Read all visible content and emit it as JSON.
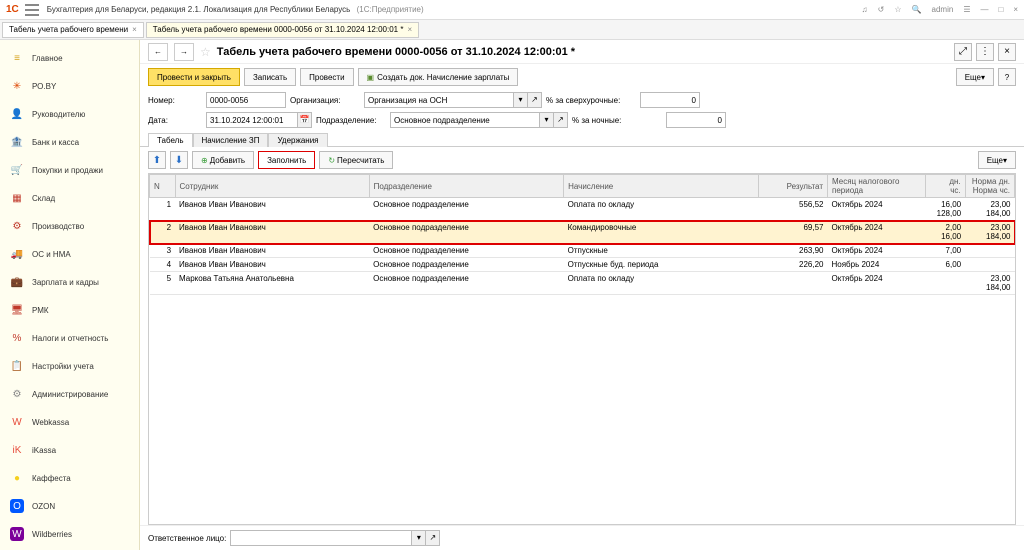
{
  "titlebar": {
    "app": "Бухгалтерия для Беларуси, редакция 2.1. Локализация для Республики Беларусь",
    "platform": "(1С:Предприятие)",
    "user": "admin"
  },
  "tabs": [
    {
      "label": "Табель учета рабочего времени",
      "active": false
    },
    {
      "label": "Табель учета рабочего времени 0000-0056 от 31.10.2024 12:00:01 *",
      "active": true
    }
  ],
  "sidebar": {
    "items": [
      {
        "icon": "≡",
        "color": "#d4a017",
        "label": "Главное"
      },
      {
        "icon": "✳",
        "color": "#d40",
        "label": "РО.BY"
      },
      {
        "icon": "👤",
        "color": "#c0392b",
        "label": "Руководителю"
      },
      {
        "icon": "🏦",
        "color": "#c0392b",
        "label": "Банк и касса"
      },
      {
        "icon": "🛒",
        "color": "#c0392b",
        "label": "Покупки и продажи"
      },
      {
        "icon": "▦",
        "color": "#c0392b",
        "label": "Склад"
      },
      {
        "icon": "⚙",
        "color": "#c0392b",
        "label": "Производство"
      },
      {
        "icon": "🚚",
        "color": "#555",
        "label": "ОС и НМА"
      },
      {
        "icon": "💼",
        "color": "#c0392b",
        "label": "Зарплата и кадры"
      },
      {
        "icon": "🖥",
        "color": "#c0392b",
        "label": "РМК"
      },
      {
        "icon": "%",
        "color": "#c0392b",
        "label": "Налоги и отчетность"
      },
      {
        "icon": "📋",
        "color": "#c0392b",
        "label": "Настройки учета"
      },
      {
        "icon": "⚙",
        "color": "#888",
        "label": "Администрирование"
      },
      {
        "icon": "W",
        "color": "#e74c3c",
        "label": "Webkassa"
      },
      {
        "icon": "iK",
        "color": "#e74c3c",
        "label": "iKassa"
      },
      {
        "icon": "●",
        "color": "#f5d020",
        "label": "Каффеста"
      },
      {
        "icon": "O",
        "color": "#fff",
        "bg": "#0058ff",
        "label": "OZON"
      },
      {
        "icon": "W",
        "color": "#fff",
        "bg": "#7b0099",
        "label": "Wildberries"
      }
    ]
  },
  "document": {
    "nav_back": "←",
    "nav_fwd": "→",
    "title": "Табель учета рабочего времени 0000-0056 от 31.10.2024 12:00:01 *",
    "toolbar": {
      "post_close": "Провести и закрыть",
      "save": "Записать",
      "post": "Провести",
      "create_doc": "Создать док. Начисление зарплаты",
      "more": "Еще"
    },
    "fields": {
      "number_label": "Номер:",
      "number": "0000-0056",
      "org_label": "Организация:",
      "org": "Организация на ОСН",
      "overtime_label": "% за сверхурочные:",
      "overtime": "0",
      "date_label": "Дата:",
      "date": "31.10.2024 12:00:01",
      "dept_label": "Подразделение:",
      "dept": "Основное подразделение",
      "night_label": "% за ночные:",
      "night": "0"
    },
    "inner_tabs": [
      "Табель",
      "Начисление ЗП",
      "Удержания"
    ],
    "inner_tab_active": 0,
    "table_toolbar": {
      "add": "Добавить",
      "fill": "Заполнить",
      "recount": "Пересчитать",
      "more": "Еще"
    },
    "columns": {
      "n": "N",
      "employee": "Сотрудник",
      "dept": "Подразделение",
      "accrual": "Начисление",
      "result": "Результат",
      "period": "Месяц налогового периода",
      "days": "дн.",
      "hrs": "чс.",
      "norm_days": "Норма дн.",
      "norm_hrs": "Норма чс."
    },
    "rows": [
      {
        "n": "1",
        "employee": "Иванов Иван Иванович",
        "dept": "Основное подразделение",
        "accrual": "Оплата по окладу",
        "result": "556,52",
        "period": "Октябрь 2024",
        "days": "16,00",
        "hrs": "128,00",
        "norm_days": "23,00",
        "norm_hrs": "184,00",
        "hl": false
      },
      {
        "n": "2",
        "employee": "Иванов Иван Иванович",
        "dept": "Основное подразделение",
        "accrual": "Командировочные",
        "result": "69,57",
        "period": "Октябрь 2024",
        "days": "2,00",
        "hrs": "16,00",
        "norm_days": "23,00",
        "norm_hrs": "184,00",
        "hl": true
      },
      {
        "n": "3",
        "employee": "Иванов Иван Иванович",
        "dept": "Основное подразделение",
        "accrual": "Отпускные",
        "result": "263,90",
        "period": "Октябрь 2024",
        "days": "7,00",
        "hrs": "",
        "norm_days": "",
        "norm_hrs": "",
        "hl": false
      },
      {
        "n": "4",
        "employee": "Иванов Иван Иванович",
        "dept": "Основное подразделение",
        "accrual": "Отпускные буд. периода",
        "result": "226,20",
        "period": "Ноябрь 2024",
        "days": "6,00",
        "hrs": "",
        "norm_days": "",
        "norm_hrs": "",
        "hl": false
      },
      {
        "n": "5",
        "employee": "Маркова Татьяна Анатольевна",
        "dept": "Основное подразделение",
        "accrual": "Оплата по окладу",
        "result": "",
        "period": "Октябрь 2024",
        "days": "",
        "hrs": "",
        "norm_days": "23,00",
        "norm_hrs": "184,00",
        "hl": false
      }
    ],
    "footer": {
      "resp_label": "Ответственное лицо:",
      "resp": ""
    }
  }
}
